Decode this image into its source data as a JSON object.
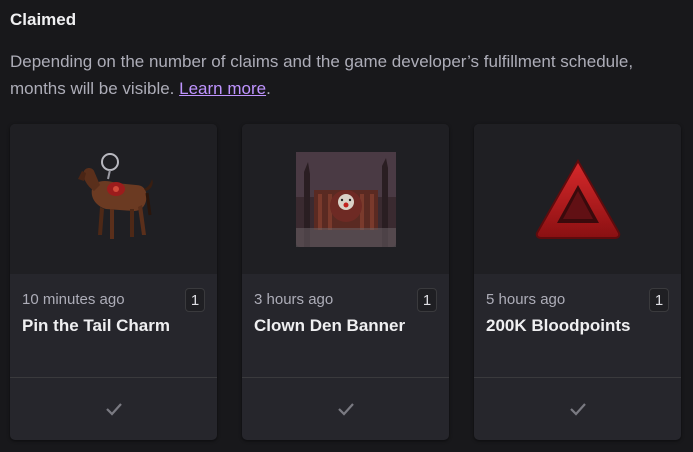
{
  "section": {
    "title": "Claimed",
    "description_line1": "Depending on the number of claims and the game developer’s fulfillment schedule,",
    "description_line2_prefix": "months will be visible. ",
    "learn_more": "Learn more",
    "description_line2_suffix": "."
  },
  "cards": [
    {
      "time": "10 minutes ago",
      "quantity": "1",
      "title": "Pin the Tail Charm",
      "image_icon": "horse-charm-icon",
      "status_icon": "checkmark-icon"
    },
    {
      "time": "3 hours ago",
      "quantity": "1",
      "title": "Clown Den Banner",
      "image_icon": "clown-banner-icon",
      "status_icon": "checkmark-icon"
    },
    {
      "time": "5 hours ago",
      "quantity": "1",
      "title": "200K Bloodpoints",
      "image_icon": "bloodpoints-icon",
      "status_icon": "checkmark-icon"
    }
  ],
  "colors": {
    "background": "#18181b",
    "card": "#26262c",
    "link": "#bf94ff",
    "muted_text": "#adadb8",
    "bloodpoint_red": "#b5161a"
  }
}
